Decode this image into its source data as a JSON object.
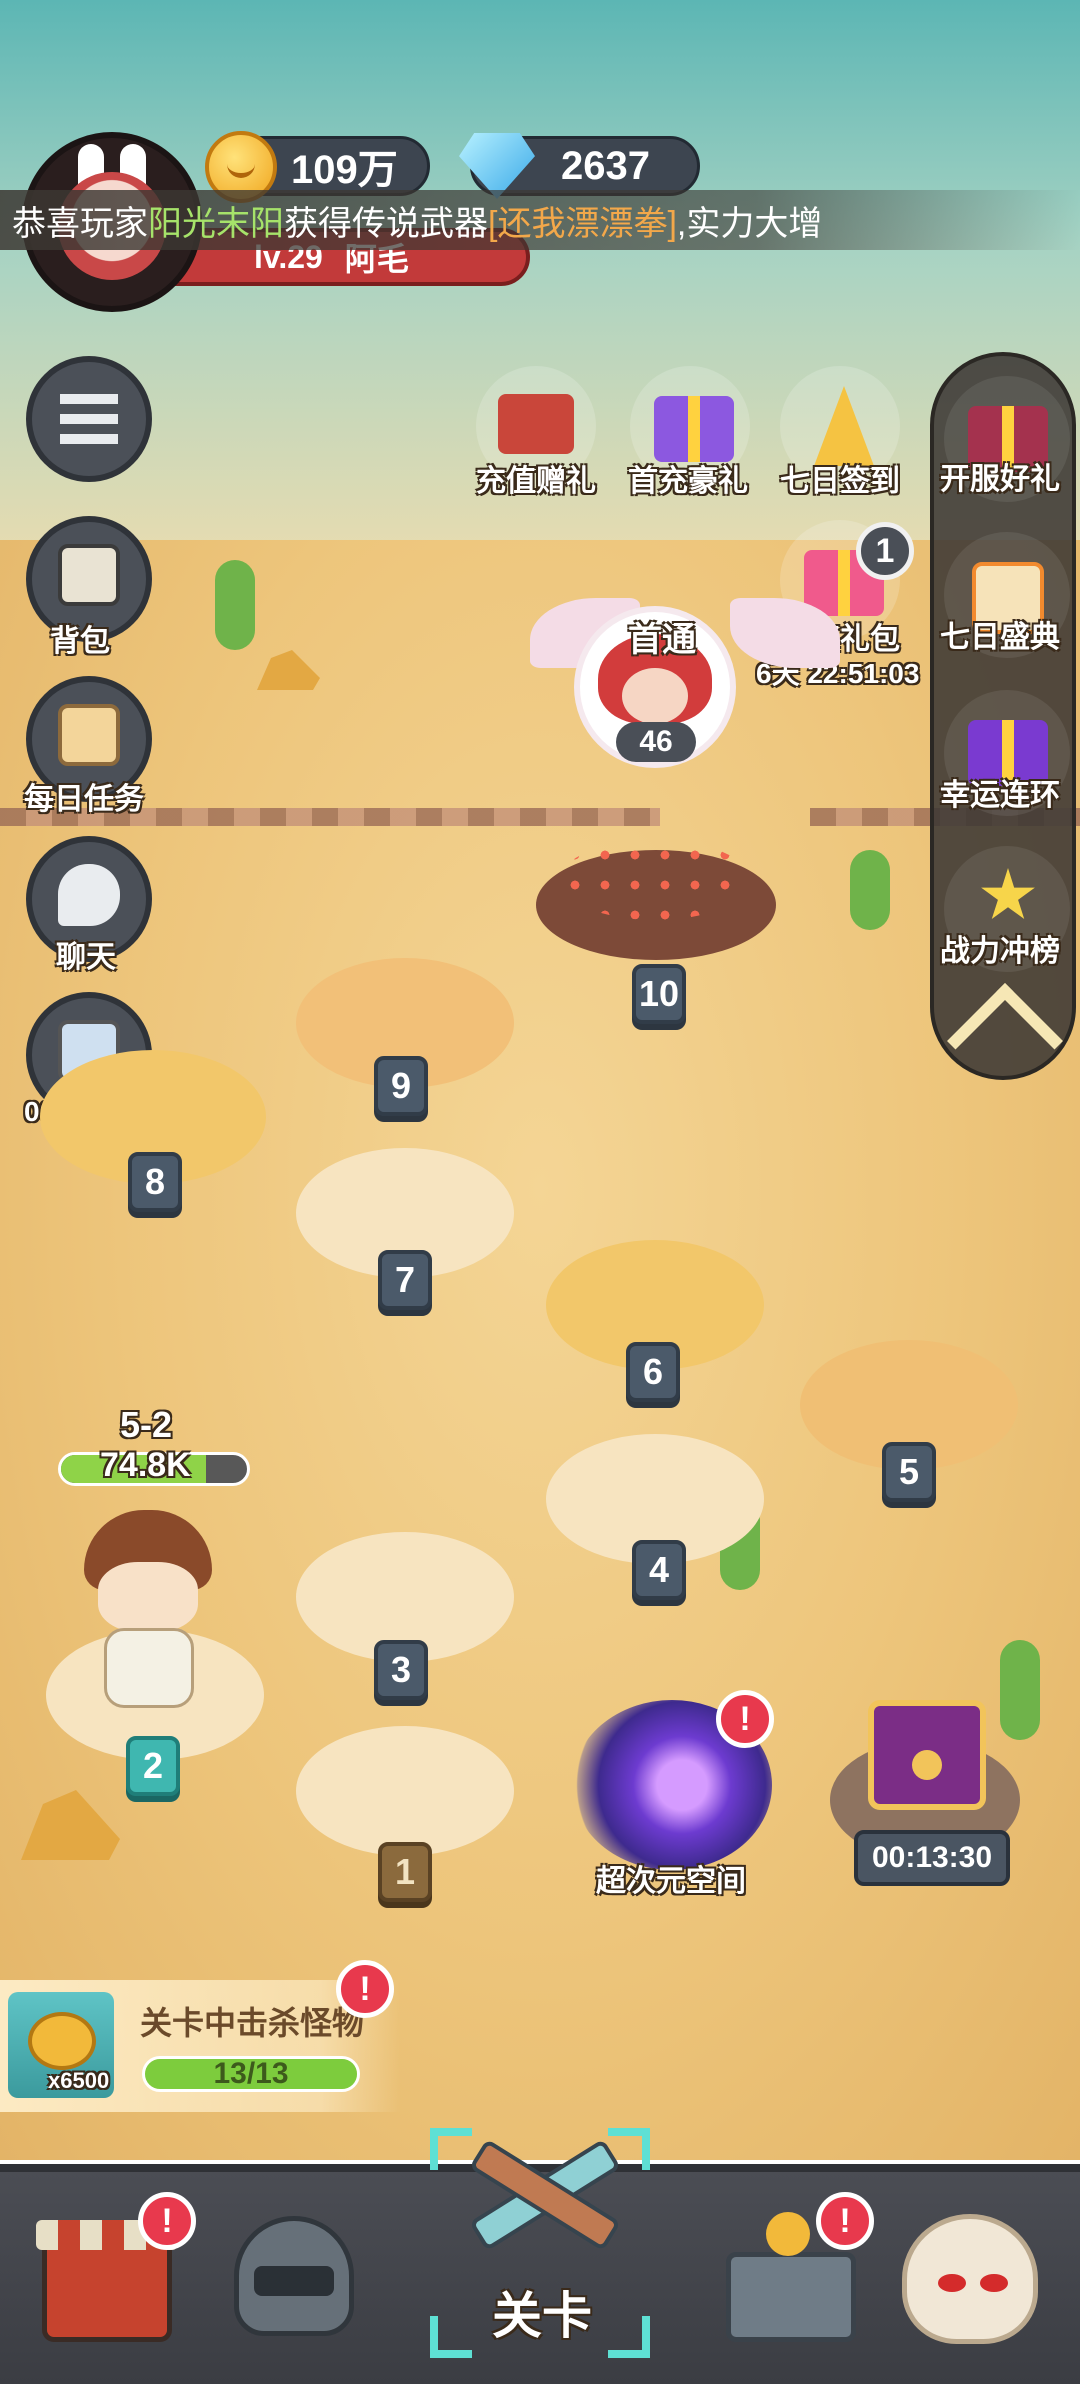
{
  "header": {
    "gold": "109万",
    "gems": "2637",
    "level": "lv.29",
    "player_name": "阿毛"
  },
  "ticker": {
    "prefix": "恭喜玩家",
    "player": "阳光末阳",
    "middle": "获得传说武器",
    "item": "[还我漂漂拳]",
    "suffix": ",实力大增"
  },
  "left_menu": {
    "bag": "背包",
    "daily": "每日任务",
    "chat": "聊天",
    "ad_timer": "00:09:43"
  },
  "top_icons": {
    "recharge_gift": "充值赠礼",
    "first_recharge": "首充豪礼",
    "seven_day_signin": "七日签到",
    "value_pack": "超值礼包",
    "value_pack_badge": "1",
    "value_pack_timer": "6天 22:51:03"
  },
  "right_menu": {
    "server_gift": "开服好礼",
    "seven_day_festival": "七日盛典",
    "lucky_chain": "幸运连环",
    "power_rank": "战力冲榜"
  },
  "boss": {
    "label": "首通",
    "count": "46"
  },
  "levels": [
    "1",
    "2",
    "3",
    "4",
    "5",
    "6",
    "7",
    "8",
    "9",
    "10"
  ],
  "hero": {
    "stage": "5-2",
    "power": "74.8K",
    "hp_fraction": 0.78
  },
  "portal": {
    "label": "超次元空间",
    "alert": "!"
  },
  "chest": {
    "timer": "00:13:30"
  },
  "quest": {
    "title": "关卡中击杀怪物",
    "progress": "13/13",
    "fraction": 1.0,
    "reward": "x6500",
    "alert": "!"
  },
  "bottom_nav": {
    "center_label": "关卡",
    "alert": "!"
  },
  "colors": {
    "sky": "#5cb6b4",
    "sand": "#f4d595",
    "current_level": "#3fb7b0",
    "alert": "#e8394d"
  }
}
